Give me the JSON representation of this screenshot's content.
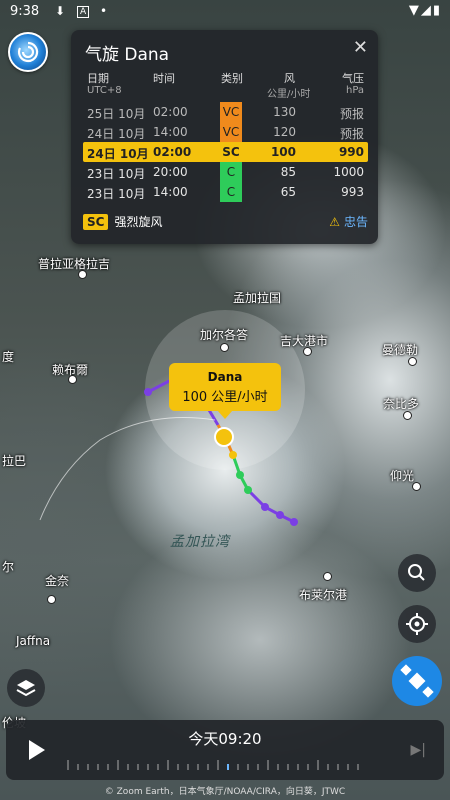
{
  "status_bar": {
    "time": "9:38"
  },
  "card": {
    "title": "气旋 Dana",
    "close_icon": "close-icon",
    "headers": {
      "date": "日期",
      "date_sub": "UTC+8",
      "time": "时间",
      "category": "类别",
      "wind": "风",
      "wind_unit": "公里/小时",
      "pressure": "气压",
      "pressure_unit": "hPa"
    },
    "rows": [
      {
        "date": "25日 10月",
        "time": "02:00",
        "category": "VC",
        "wind": "130",
        "pressure": "预报",
        "cat_color": "#f08a1c",
        "state": "forecast"
      },
      {
        "date": "24日 10月",
        "time": "14:00",
        "category": "VC",
        "wind": "120",
        "pressure": "预报",
        "cat_color": "#f08a1c",
        "state": "forecast"
      },
      {
        "date": "24日 10月",
        "time": "02:00",
        "category": "SC",
        "wind": "100",
        "pressure": "990",
        "cat_color": "#f4c20d",
        "state": "current"
      },
      {
        "date": "23日 10月",
        "time": "20:00",
        "category": "C",
        "wind": "85",
        "pressure": "1000",
        "cat_color": "#2ecc5a",
        "state": "past"
      },
      {
        "date": "23日 10月",
        "time": "14:00",
        "category": "C",
        "wind": "65",
        "pressure": "993",
        "cat_color": "#2ecc5a",
        "state": "past"
      }
    ],
    "legend": {
      "badge": "SC",
      "label": "强烈旋风"
    },
    "warning": {
      "label": "忠告"
    }
  },
  "map": {
    "places": [
      "普拉亚格拉吉",
      "孟加拉国",
      "加尔各答",
      "吉大港市",
      "曼德勒",
      "度",
      "赖布爾",
      "奈比多",
      "拉巴",
      "仰光",
      "布莱尔港",
      "金奈",
      "Jaffna",
      "尔",
      "伦坡"
    ],
    "sea_label": "孟加拉湾",
    "storm_popup": {
      "name": "Dana",
      "speed": "100 公里/小时"
    }
  },
  "controls": {
    "search_icon": "search-icon",
    "locate_icon": "crosshair-icon",
    "satellite_icon": "satellite-icon",
    "layers_icon": "layers-icon"
  },
  "timeline": {
    "now_label": "今天09:20"
  },
  "credit": "© Zoom Earth，日本气象厅/NOAA/CIRA，向日葵，JTWC",
  "colors": {
    "accent": "#f4c20d",
    "link": "#6cb7ff",
    "very_severe": "#f08a1c",
    "cyclone": "#2ecc5a",
    "track_depression": "#7b3fe4",
    "satellite_button": "#1e88e5"
  }
}
